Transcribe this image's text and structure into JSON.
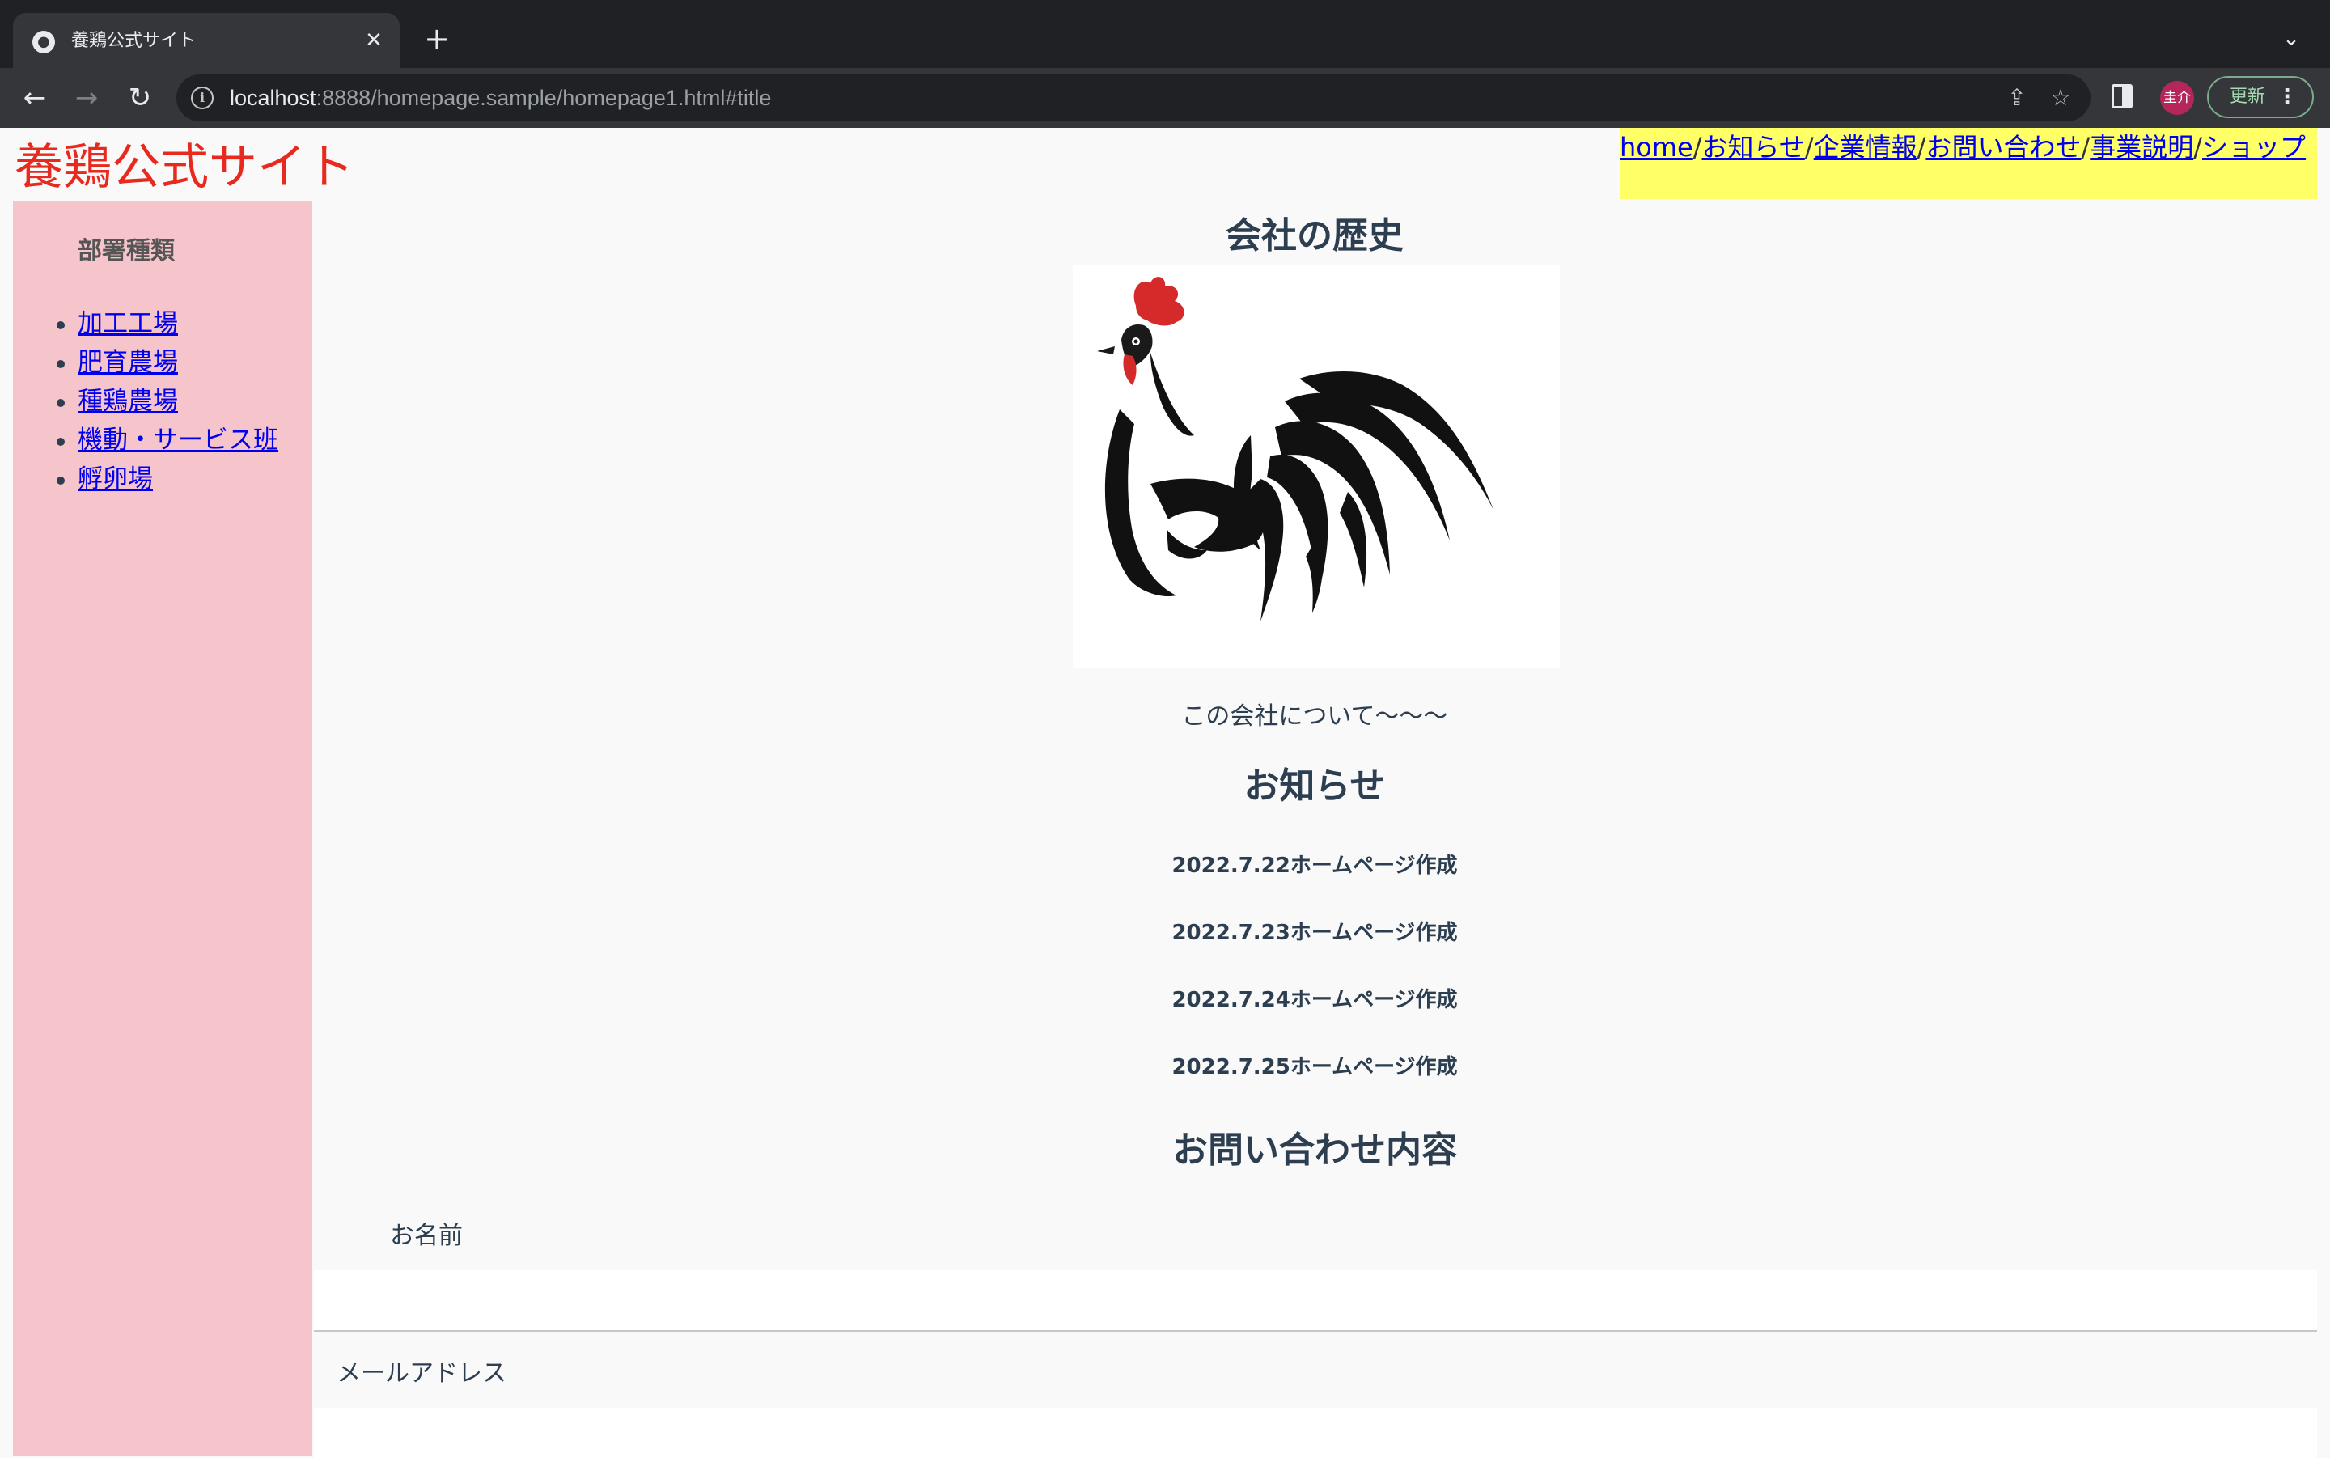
{
  "browser": {
    "tab_title": "養鶏公式サイト",
    "tab_close": "✕",
    "new_tab": "+",
    "tab_list": "⌄",
    "url_host": "localhost",
    "url_rest": ":8888/homepage.sample/homepage1.html#title",
    "back": "←",
    "forward": "→",
    "reload": "↻",
    "share_icon": "⇪",
    "bookmark_icon": "☆",
    "avatar_text": "圭介",
    "update_label": "更新",
    "menu_dots": "⋮"
  },
  "site": {
    "title": "養鶏公式サイト",
    "title_color": "#e8291e"
  },
  "top_nav": {
    "items": [
      "home",
      "お知らせ",
      "企業情報",
      "お問い合わせ",
      "事業説明",
      "ショップ"
    ],
    "separator": "/",
    "background": "#ffff66"
  },
  "sidebar": {
    "heading": "部署種類",
    "items": [
      "加工工場",
      "肥育農場",
      "種鶏農場",
      "機動・サービス班",
      "孵卵場"
    ],
    "background": "#f5c5cb"
  },
  "main": {
    "history_heading": "会社の歴史",
    "about_text": "この会社について〜〜〜",
    "news_heading": "お知らせ",
    "news_items": [
      "2022.7.22ホームページ作成",
      "2022.7.23ホームページ作成",
      "2022.7.24ホームページ作成",
      "2022.7.25ホームページ作成"
    ],
    "contact_heading": "お問い合わせ内容",
    "name_label": "お名前",
    "email_label": "メールアドレス"
  }
}
